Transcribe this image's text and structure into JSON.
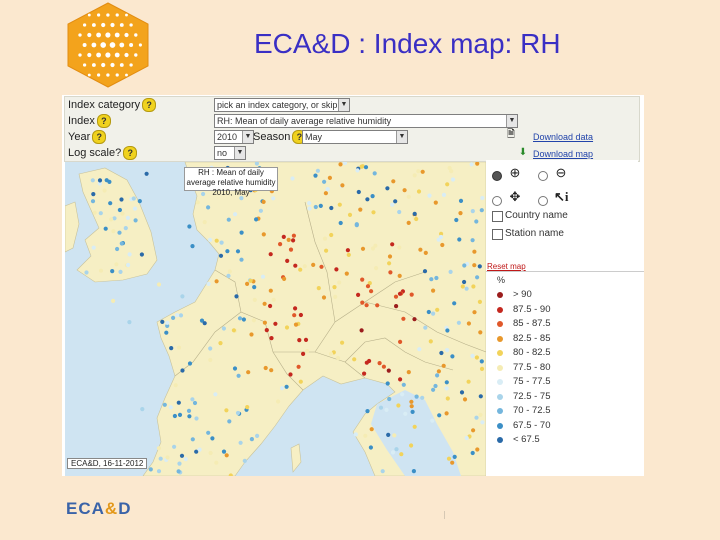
{
  "slide": {
    "title": "ECA&D : Index map: RH",
    "footer_logo": {
      "left": "ECA",
      "amp": "&",
      "right": "D"
    }
  },
  "form": {
    "index_category": {
      "label": "Index category",
      "value": "pick an index category, or skip..."
    },
    "index": {
      "label": "Index",
      "value": "RH: Mean of daily average relative humidity"
    },
    "year": {
      "label": "Year",
      "value": "2010"
    },
    "season": {
      "label": "Season",
      "value": "May"
    },
    "log_scale": {
      "label": "Log scale?",
      "value": "no"
    },
    "help_glyph": "?"
  },
  "downloads": {
    "data": "Download data",
    "map": "Download map"
  },
  "tools": {
    "zoom_in": "zoom-in-icon",
    "zoom_out": "zoom-out-icon",
    "pan": "pan-icon",
    "info": "info-icon",
    "country_name": "Country name",
    "station_name": "Station name",
    "reset_map": "Reset map"
  },
  "map": {
    "title_line1": "RH : Mean of daily average relative humidity",
    "title_line2": "2010, May",
    "credit": "ECA&D, 16-11-2012",
    "colors": {
      "sea": "#cfe4f2",
      "land": "#f6efc4"
    }
  },
  "legend": {
    "unit": "%",
    "items": [
      {
        "label": "> 90",
        "color": "#9b1d1d"
      },
      {
        "label": "87.5 - 90",
        "color": "#c4281f"
      },
      {
        "label": "85 - 87.5",
        "color": "#e0582a"
      },
      {
        "label": "82.5 - 85",
        "color": "#e8982c"
      },
      {
        "label": "80 - 82.5",
        "color": "#f2d35a"
      },
      {
        "label": "77.5 - 80",
        "color": "#f5ecb4"
      },
      {
        "label": "75 - 77.5",
        "color": "#d9edf5"
      },
      {
        "label": "72.5 - 75",
        "color": "#a9d4ea"
      },
      {
        "label": "70 - 72.5",
        "color": "#74b6dd"
      },
      {
        "label": "67.5 - 70",
        "color": "#3b8fc6"
      },
      {
        "label": "< 67.5",
        "color": "#2a6aa8"
      }
    ]
  }
}
